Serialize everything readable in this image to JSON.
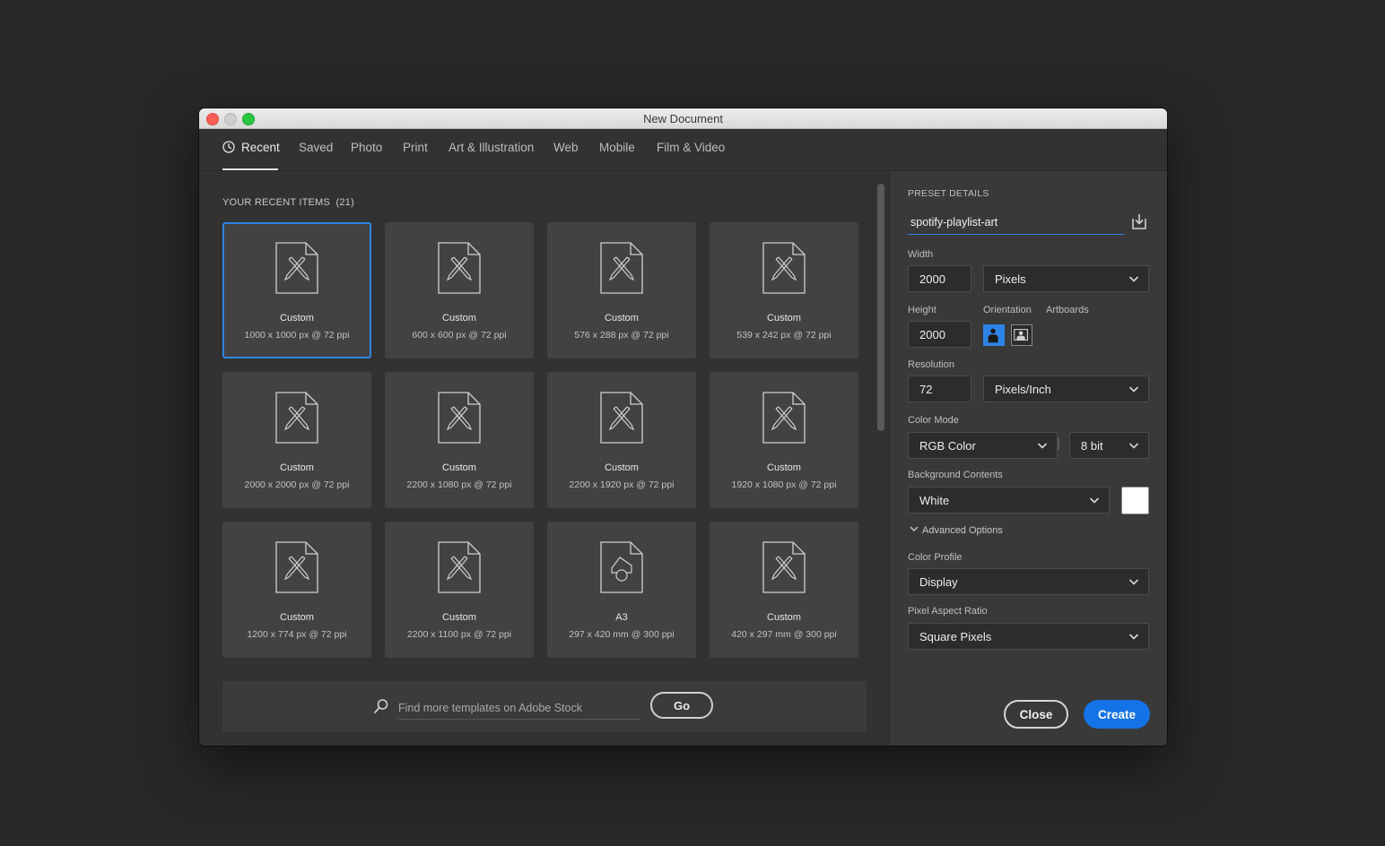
{
  "window": {
    "title": "New Document"
  },
  "tabs": [
    "Recent",
    "Saved",
    "Photo",
    "Print",
    "Art & Illustration",
    "Web",
    "Mobile",
    "Film & Video"
  ],
  "active_tab": "Recent",
  "recent": {
    "heading": "YOUR RECENT ITEMS",
    "count": "(21)",
    "items": [
      {
        "title": "Custom",
        "sub": "1000 x 1000 px @ 72 ppi",
        "icon": "document-pencil-icon",
        "selected": true
      },
      {
        "title": "Custom",
        "sub": "600 x 600 px @ 72 ppi",
        "icon": "document-pencil-icon"
      },
      {
        "title": "Custom",
        "sub": "576 x 288 px @ 72 ppi",
        "icon": "document-pencil-icon"
      },
      {
        "title": "Custom",
        "sub": "539 x 242 px @ 72 ppi",
        "icon": "document-pencil-icon"
      },
      {
        "title": "Custom",
        "sub": "2000 x 2000 px @ 72 ppi",
        "icon": "document-pencil-icon"
      },
      {
        "title": "Custom",
        "sub": "2200 x 1080 px @ 72 ppi",
        "icon": "document-pencil-icon"
      },
      {
        "title": "Custom",
        "sub": "2200 x 1920 px @ 72 ppi",
        "icon": "document-pencil-icon"
      },
      {
        "title": "Custom",
        "sub": "1920 x 1080 px @ 72 ppi",
        "icon": "document-pencil-icon"
      },
      {
        "title": "Custom",
        "sub": "1200 x 774 px @ 72 ppi",
        "icon": "document-pencil-icon"
      },
      {
        "title": "Custom",
        "sub": "2200 x 1100 px @ 72 ppi",
        "icon": "document-pencil-icon"
      },
      {
        "title": "A3",
        "sub": "297 x 420 mm @ 300 ppi",
        "icon": "document-shapes-icon"
      },
      {
        "title": "Custom",
        "sub": "420 x 297 mm @ 300 ppi",
        "icon": "document-pencil-icon"
      }
    ]
  },
  "stock": {
    "placeholder": "Find more templates on Adobe Stock",
    "go_label": "Go"
  },
  "preset": {
    "heading": "PRESET DETAILS",
    "name": "spotify-playlist-art",
    "width_label": "Width",
    "width": "2000",
    "width_unit": "Pixels",
    "height_label": "Height",
    "height": "2000",
    "orientation_label": "Orientation",
    "artboards_label": "Artboards",
    "resolution_label": "Resolution",
    "resolution": "72",
    "resolution_unit": "Pixels/Inch",
    "color_mode_label": "Color Mode",
    "color_mode": "RGB Color",
    "bit_depth": "8 bit",
    "background_label": "Background Contents",
    "background": "White",
    "background_color": "#ffffff",
    "advanced_label": "Advanced Options",
    "color_profile_label": "Color Profile",
    "color_profile": "Display",
    "pixel_aspect_label": "Pixel Aspect Ratio",
    "pixel_aspect": "Square Pixels"
  },
  "buttons": {
    "close": "Close",
    "create": "Create"
  },
  "colors": {
    "accent": "#1473e6",
    "selection": "#2e84e6",
    "panel": "#323232",
    "card": "#424242"
  }
}
